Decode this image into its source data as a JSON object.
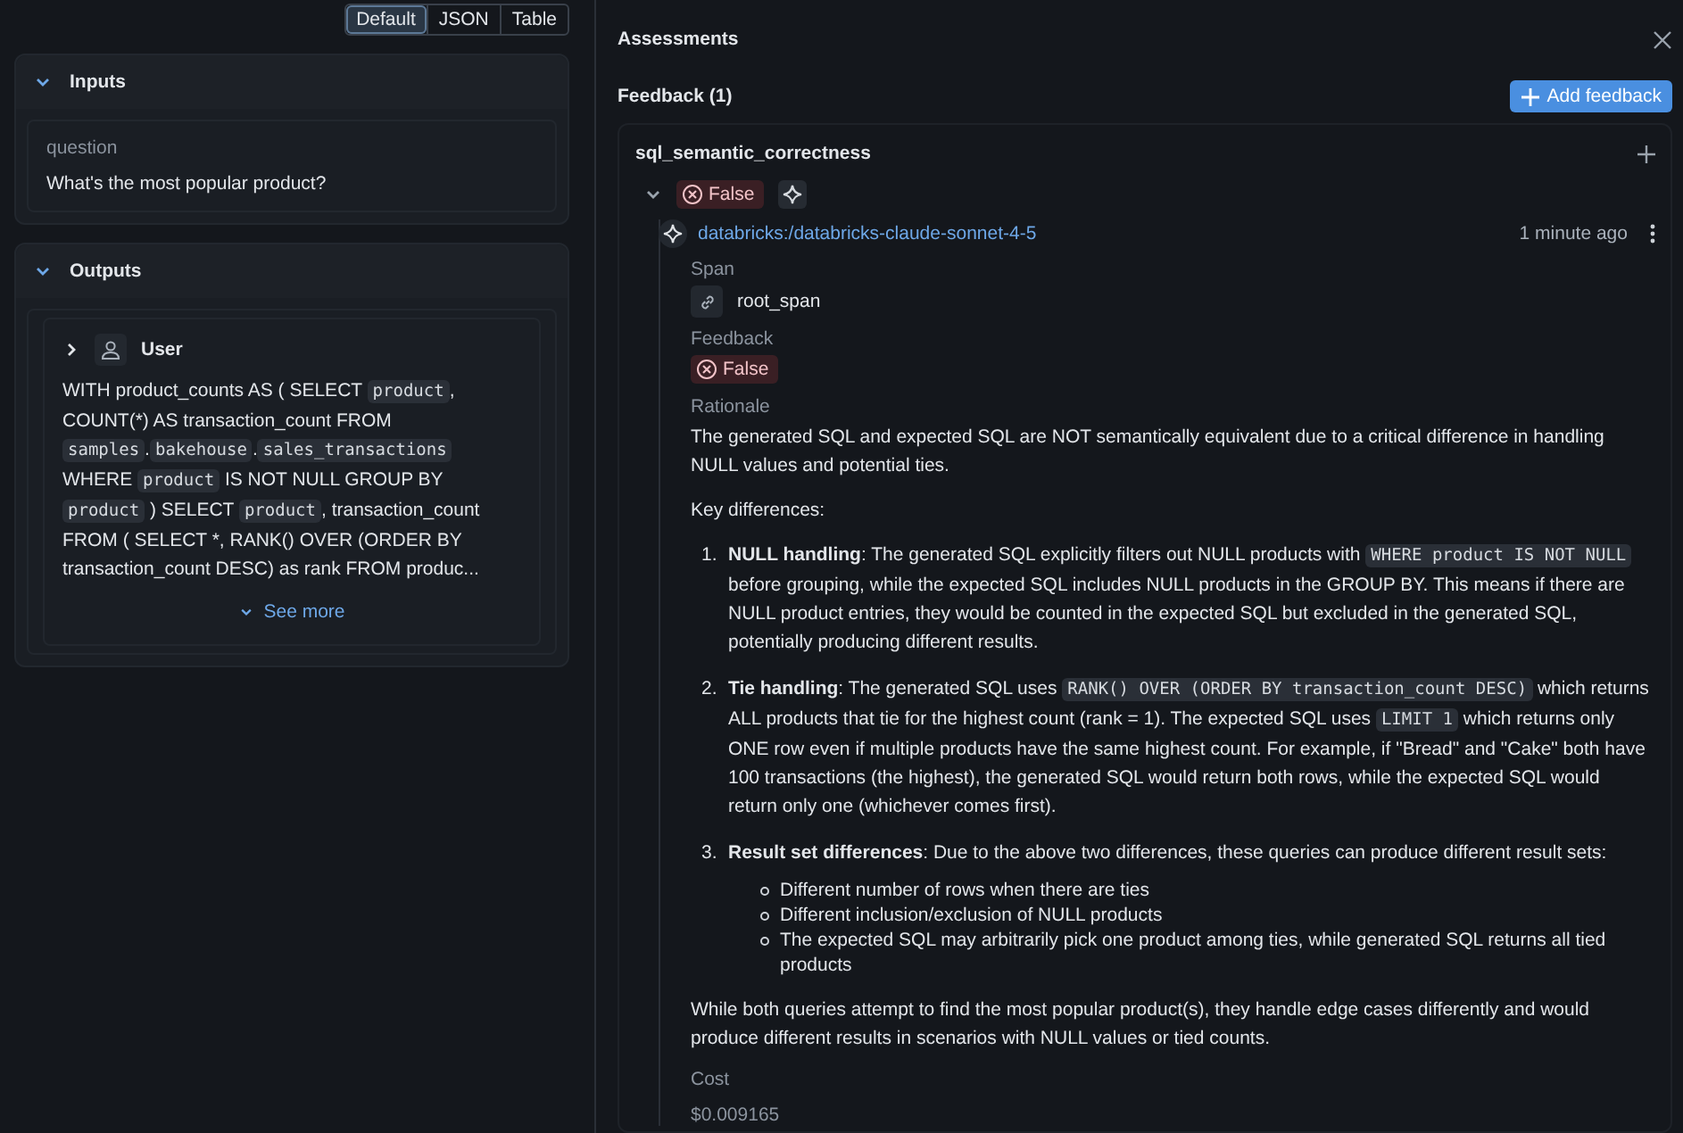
{
  "view_toggle": [
    {
      "label": "Default",
      "selected": true
    },
    {
      "label": "JSON",
      "selected": false
    },
    {
      "label": "Table",
      "selected": false
    }
  ],
  "inputs": {
    "title": "Inputs",
    "expanded": true,
    "fields": [
      {
        "key": "question",
        "value": "What's the most popular product?"
      }
    ]
  },
  "outputs": {
    "title": "Outputs",
    "expanded": true,
    "message": {
      "role": "User",
      "expanded": false,
      "segments": [
        {
          "kind": "text",
          "text": "WITH product_counts AS ( SELECT "
        },
        {
          "kind": "code",
          "text": "product"
        },
        {
          "kind": "text",
          "text": ", COUNT(*) AS transaction_count FROM "
        },
        {
          "kind": "code",
          "text": "samples"
        },
        {
          "kind": "text",
          "text": "."
        },
        {
          "kind": "code",
          "text": "bakehouse"
        },
        {
          "kind": "text",
          "text": "."
        },
        {
          "kind": "code",
          "text": "sales_transactions"
        },
        {
          "kind": "text",
          "text": " WHERE "
        },
        {
          "kind": "code",
          "text": "product"
        },
        {
          "kind": "text",
          "text": " IS NOT NULL GROUP BY "
        },
        {
          "kind": "code",
          "text": "product"
        },
        {
          "kind": "text",
          "text": " ) SELECT "
        },
        {
          "kind": "code",
          "text": "product"
        },
        {
          "kind": "text",
          "text": ", transaction_count FROM ( SELECT *, RANK() OVER (ORDER BY transaction_count DESC) as rank FROM produc..."
        }
      ]
    },
    "see_more": "See more"
  },
  "assessments": {
    "title": "Assessments",
    "feedback_heading": "Feedback (1)",
    "add_button": "Add feedback",
    "items": [
      {
        "name": "sql_semantic_correctness",
        "expanded": true,
        "value": "False",
        "passed": false,
        "source": "databricks:/databricks-claude-sonnet-4-5",
        "time": "1 minute ago",
        "span_label": "Span",
        "span": "root_span",
        "feedback_label": "Feedback",
        "feedback_value": "False",
        "rationale_label": "Rationale",
        "rationale": [
          {
            "kind": "paragraph",
            "segments": [
              {
                "kind": "text",
                "text": "The generated SQL and expected SQL are NOT semantically equivalent due to a critical difference in handling NULL values and potential ties."
              }
            ]
          },
          {
            "kind": "paragraph",
            "segments": [
              {
                "kind": "text",
                "text": "Key differences:"
              }
            ]
          },
          {
            "kind": "ordered_list",
            "items": [
              {
                "marker": "1.",
                "segments": [
                  {
                    "kind": "text",
                    "text": "**NULL handling**: The generated SQL explicitly filters out NULL products with "
                  },
                  {
                    "kind": "code",
                    "text": "WHERE product IS NOT NULL"
                  },
                  {
                    "kind": "text",
                    "text": " before grouping, while the expected SQL includes NULL products in the GROUP BY. This means if there are NULL product entries, they would be counted in the expected SQL but excluded in the generated SQL, potentially producing different results."
                  }
                ]
              },
              {
                "marker": "2.",
                "segments": [
                  {
                    "kind": "text",
                    "text": "**Tie handling**: The generated SQL uses "
                  },
                  {
                    "kind": "code",
                    "text": "RANK() OVER (ORDER BY transaction_count DESC)"
                  },
                  {
                    "kind": "text",
                    "text": " which returns ALL products that tie for the highest count (rank = 1). The expected SQL uses "
                  },
                  {
                    "kind": "code",
                    "text": "LIMIT 1"
                  },
                  {
                    "kind": "text",
                    "text": " which returns only ONE row even if multiple products have the same highest count. For example, if \"Bread\" and \"Cake\" both have 100 transactions (the highest), the generated SQL would return both rows, while the expected SQL would return only one (whichever comes first)."
                  }
                ]
              },
              {
                "marker": "3.",
                "segments": [
                  {
                    "kind": "text",
                    "text": "**Result set differences**: Due to the above two differences, these queries can produce different result sets:"
                  }
                ],
                "sub_items": [
                  "Different number of rows when there are ties",
                  "Different inclusion/exclusion of NULL products",
                  "The expected SQL may arbitrarily pick one product among ties, while generated SQL returns all tied products"
                ]
              }
            ]
          },
          {
            "kind": "paragraph",
            "segments": [
              {
                "kind": "text",
                "text": "While both queries attempt to find the most popular product(s), they handle edge cases differently and would produce different results in scenarios with NULL values or tied counts."
              }
            ]
          }
        ],
        "cost_label": "Cost",
        "cost": "$0.009165"
      }
    ]
  }
}
